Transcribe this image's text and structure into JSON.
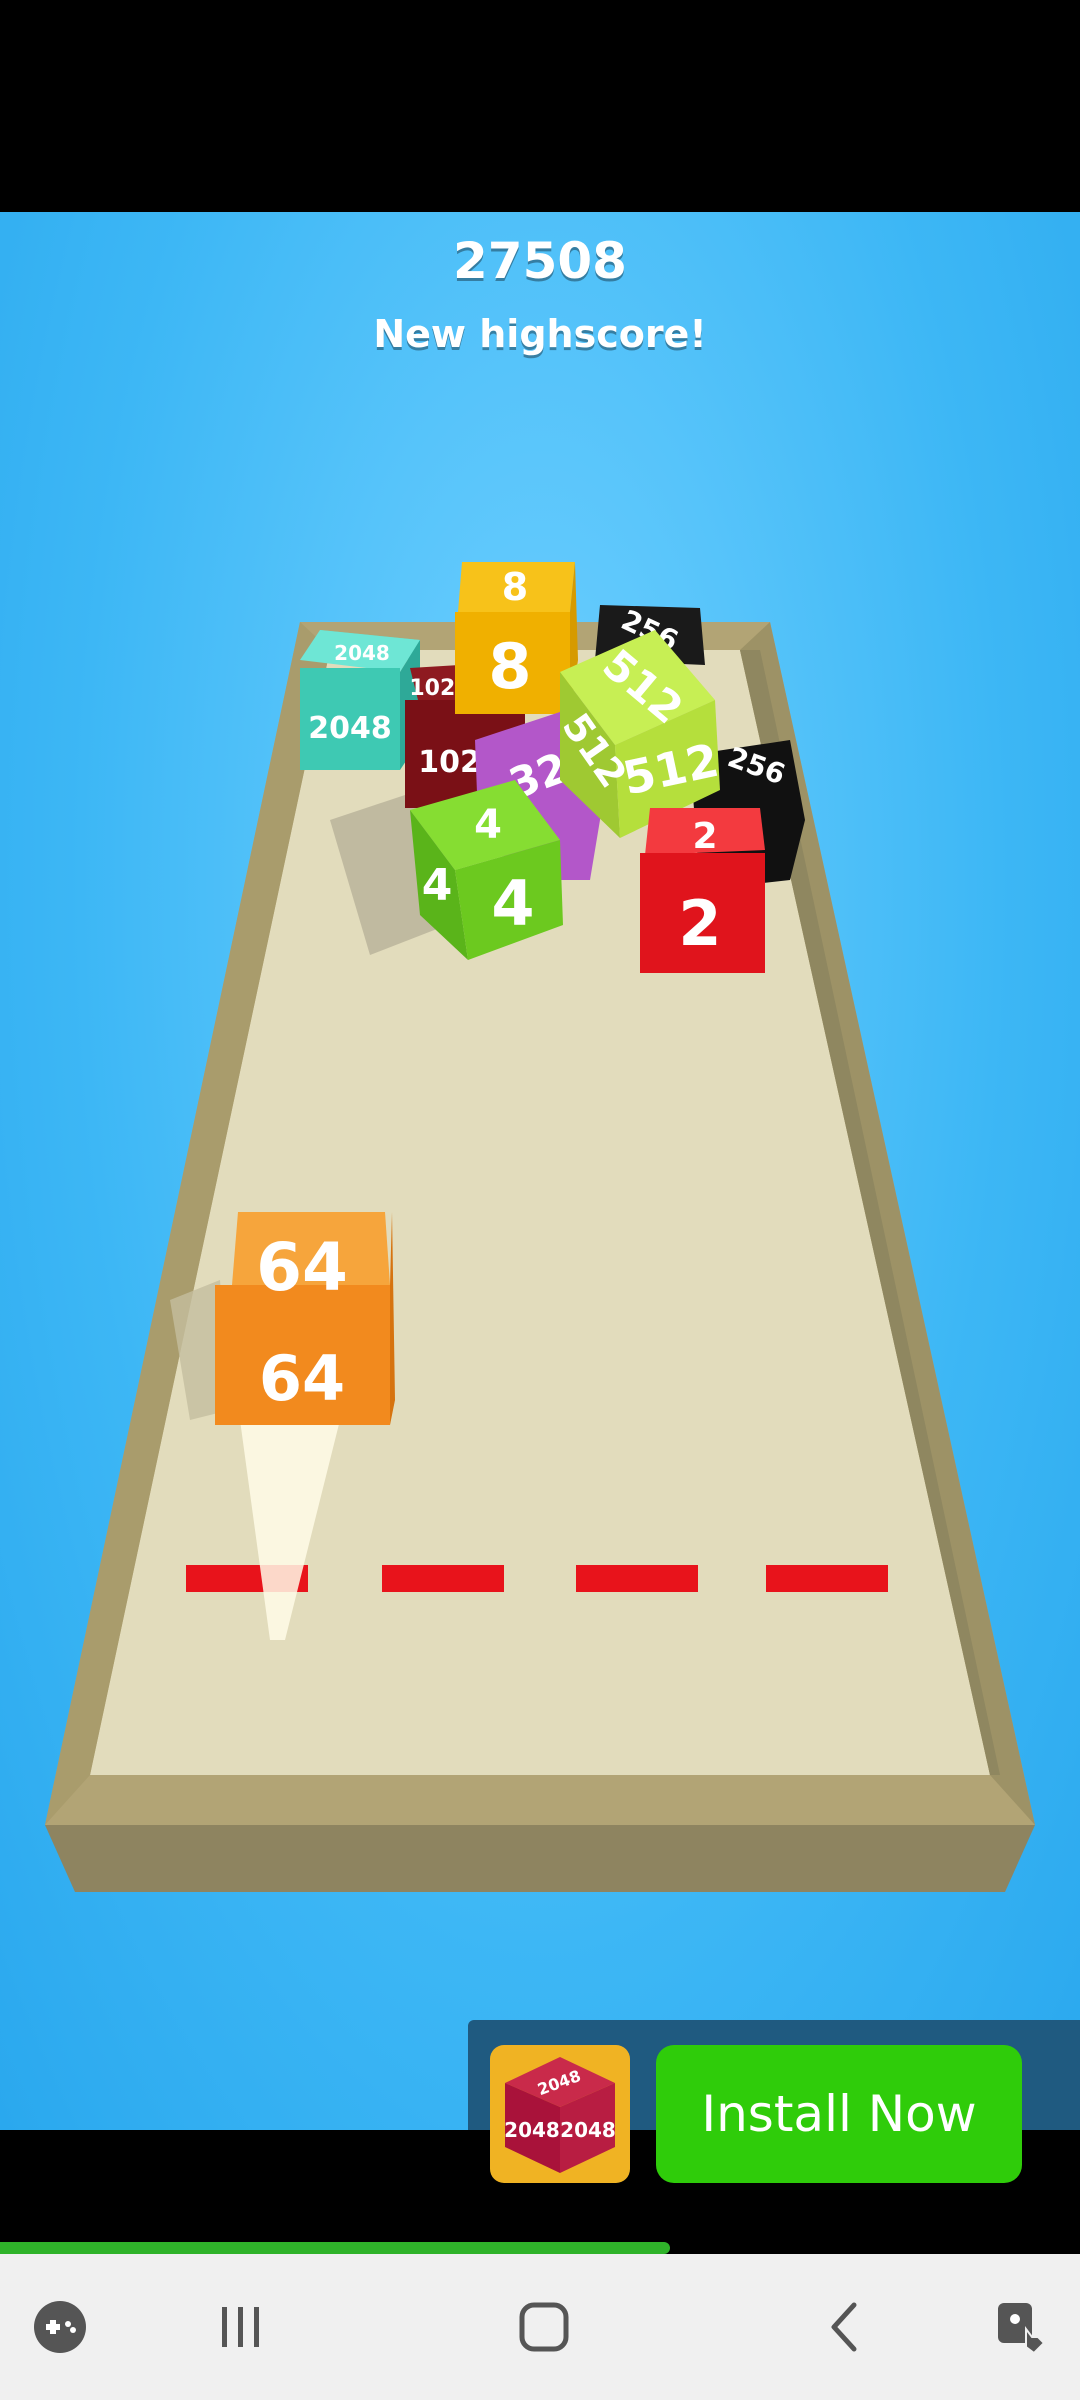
{
  "game": {
    "score": "27508",
    "subtitle": "New highscore!"
  },
  "cubes": [
    {
      "id": "cube-2048",
      "value": "2048",
      "color": "#3ec9b3"
    },
    {
      "id": "cube-8",
      "value": "8",
      "color": "#f0b000"
    },
    {
      "id": "cube-black-top",
      "value": "256",
      "color": "#111111"
    },
    {
      "id": "cube-1024",
      "value": "1024",
      "color": "#7a1016"
    },
    {
      "id": "cube-512",
      "value": "512",
      "color": "#b5df3c"
    },
    {
      "id": "cube-purple",
      "value": "32",
      "color": "#b357c9"
    },
    {
      "id": "cube-black-right",
      "value": "256",
      "color": "#111111"
    },
    {
      "id": "cube-4",
      "value": "4",
      "color": "#6cc91f"
    },
    {
      "id": "cube-2",
      "value": "2",
      "color": "#e0141c"
    },
    {
      "id": "cube-64",
      "value": "64",
      "color": "#f28a1e"
    }
  ],
  "ad": {
    "icon_labels": [
      "2048",
      "2048",
      "2048"
    ],
    "install_label": "Install Now",
    "progress": 0.62
  },
  "nav": {
    "icons": [
      "game-launcher-icon",
      "recent-apps-icon",
      "home-icon",
      "back-icon",
      "accessibility-icon"
    ]
  },
  "colors": {
    "sky": "#3db7f5",
    "board_floor": "#e2dcbc",
    "board_rim": "#b5a678",
    "dash_line": "#e8131b",
    "install_button": "#2fcc0a"
  }
}
